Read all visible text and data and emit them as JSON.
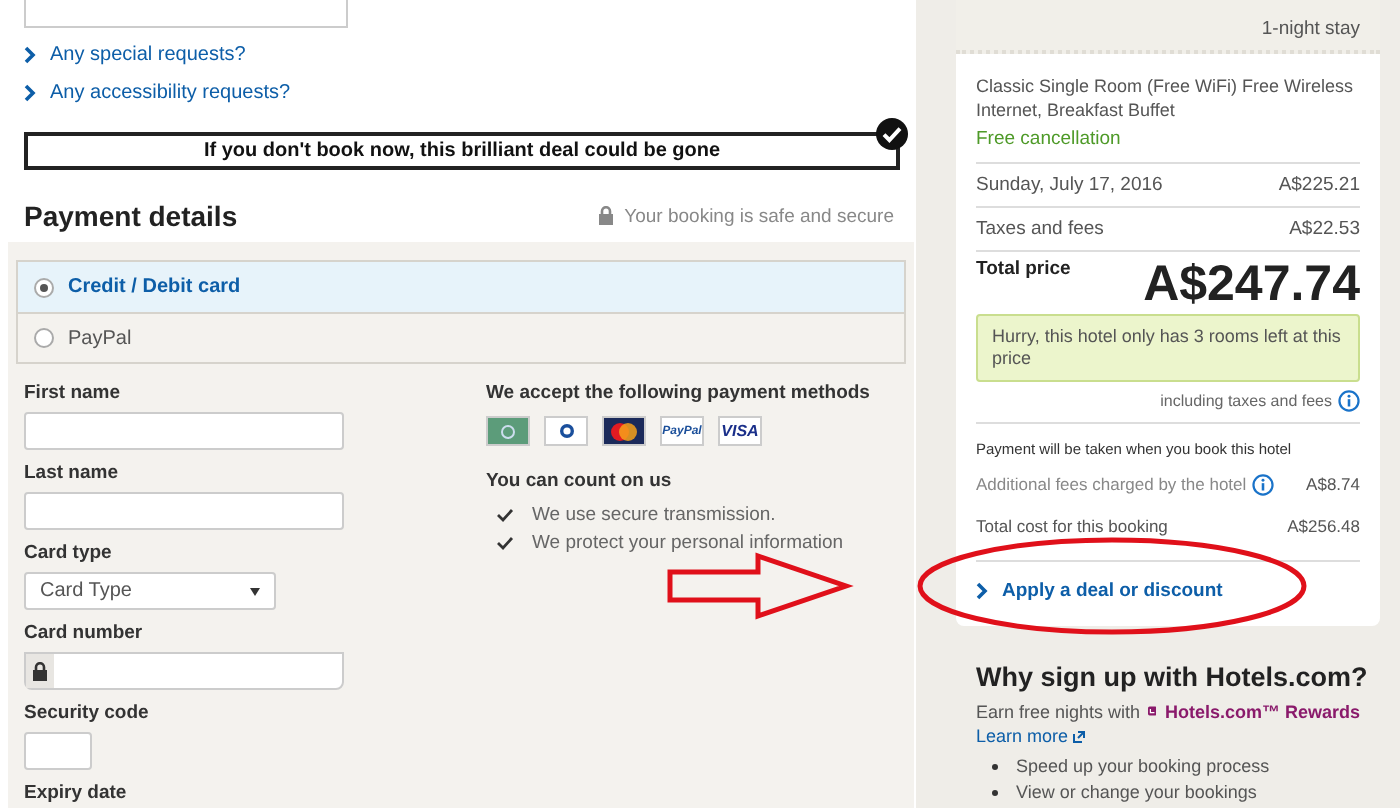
{
  "request_links": [
    {
      "label": "Any special requests?"
    },
    {
      "label": "Any accessibility requests?"
    }
  ],
  "urgency_banner": {
    "text": "If you don't book now, this brilliant deal could be gone",
    "checked": true
  },
  "payment": {
    "title": "Payment details",
    "secure_note": "Your booking is safe and secure",
    "options": [
      {
        "label": "Credit / Debit card",
        "selected": true
      },
      {
        "label": "PayPal",
        "selected": false
      }
    ],
    "fields": [
      {
        "kind": "text",
        "label": "First name"
      },
      {
        "kind": "text",
        "label": "Last name"
      },
      {
        "kind": "select",
        "label": "Card type",
        "value": "Card Type"
      },
      {
        "kind": "card",
        "label": "Card number"
      },
      {
        "kind": "short",
        "label": "Security code"
      },
      {
        "kind": "label",
        "label": "Expiry date"
      }
    ],
    "methods_title": "We accept the following payment methods",
    "methods": [
      {
        "kind": "amex"
      },
      {
        "kind": "diners"
      },
      {
        "kind": "mastercard"
      },
      {
        "kind": "paypal",
        "label": "PayPal"
      },
      {
        "kind": "visa",
        "label": "VISA"
      }
    ],
    "trust_title": "You can count on us",
    "trust_points": [
      "We use secure transmission.",
      "We protect your personal information"
    ]
  },
  "summary": {
    "stay": "1-night stay",
    "room": "Classic Single Room (Free WiFi) Free Wireless Internet, Breakfast Buffet",
    "cancellation": "Free cancellation",
    "lines": [
      {
        "label": "Sunday, July 17, 2016",
        "amount": "A$225.21"
      },
      {
        "label": "Taxes and fees",
        "amount": "A$22.53"
      }
    ],
    "total_label": "Total price",
    "total": "A$247.74",
    "alert": "Hurry, this hotel only has 3 rooms left at this price",
    "taxes_note": "including taxes and fees",
    "payment_note": "Payment will be taken when you book this hotel",
    "extra_lines": [
      {
        "label": "Additional fees charged by the hotel",
        "info": true,
        "amount": "A$8.74"
      },
      {
        "label": "Total cost for this booking",
        "info": false,
        "amount": "A$256.48"
      }
    ],
    "deal_link": "Apply a deal or discount"
  },
  "signup": {
    "title": "Why sign up with Hotels.com?",
    "earn_text": "Earn free nights with",
    "rewards": "Hotels.com™ Rewards",
    "learn_more": "Learn more",
    "benefits": [
      "Speed up your booking process",
      "View or change your bookings"
    ]
  }
}
